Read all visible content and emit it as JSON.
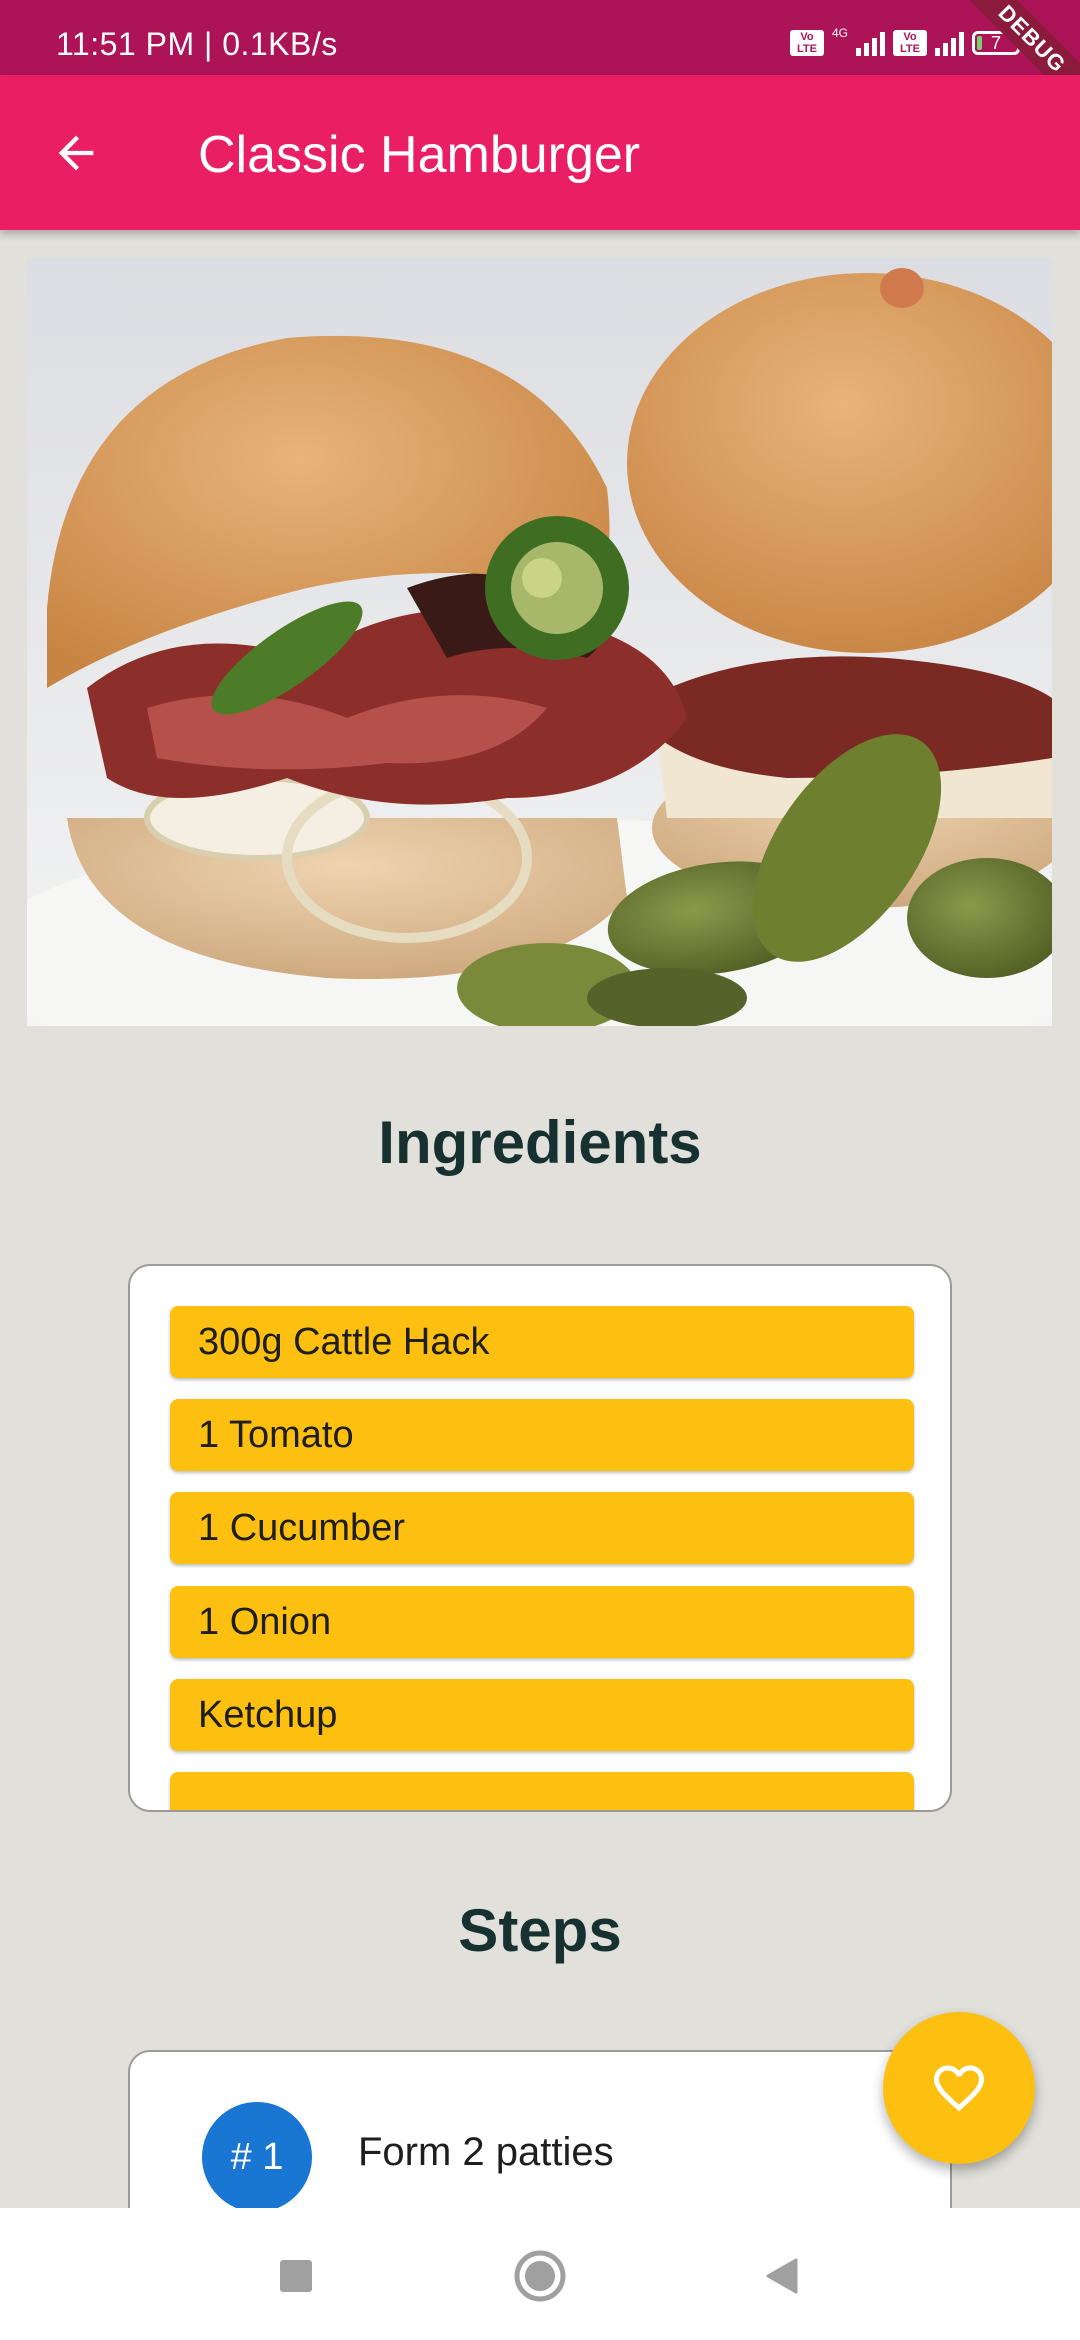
{
  "status_bar": {
    "time": "11:51 PM | 0.1KB/s",
    "lte_label": "Vo LTE",
    "network_label": "4G",
    "battery_level": "7",
    "debug_label": "DEBUG"
  },
  "app_bar": {
    "title": "Classic Hamburger",
    "back_icon": "arrow-left-icon"
  },
  "hero": {
    "alt": "Burger with bacon, onions, jalapeños and pickles"
  },
  "ingredients": {
    "heading": "Ingredients",
    "items": [
      "300g Cattle Hack",
      "1 Tomato",
      "1 Cucumber",
      "1 Onion",
      "Ketchup"
    ]
  },
  "steps": {
    "heading": "Steps",
    "items": [
      {
        "number": "# 1",
        "text": "Form 2 patties"
      }
    ]
  },
  "fab": {
    "icon": "heart-outline-icon"
  },
  "nav_bar": {
    "recent_icon": "square-icon",
    "home_icon": "circle-icon",
    "back_icon": "triangle-back-icon"
  },
  "colors": {
    "status_bar": "#ad1457",
    "app_bar": "#e91e63",
    "background": "#e1e0da",
    "ingredient_chip": "#fdc010",
    "step_badge": "#1976d2",
    "heading_text": "#163130"
  }
}
